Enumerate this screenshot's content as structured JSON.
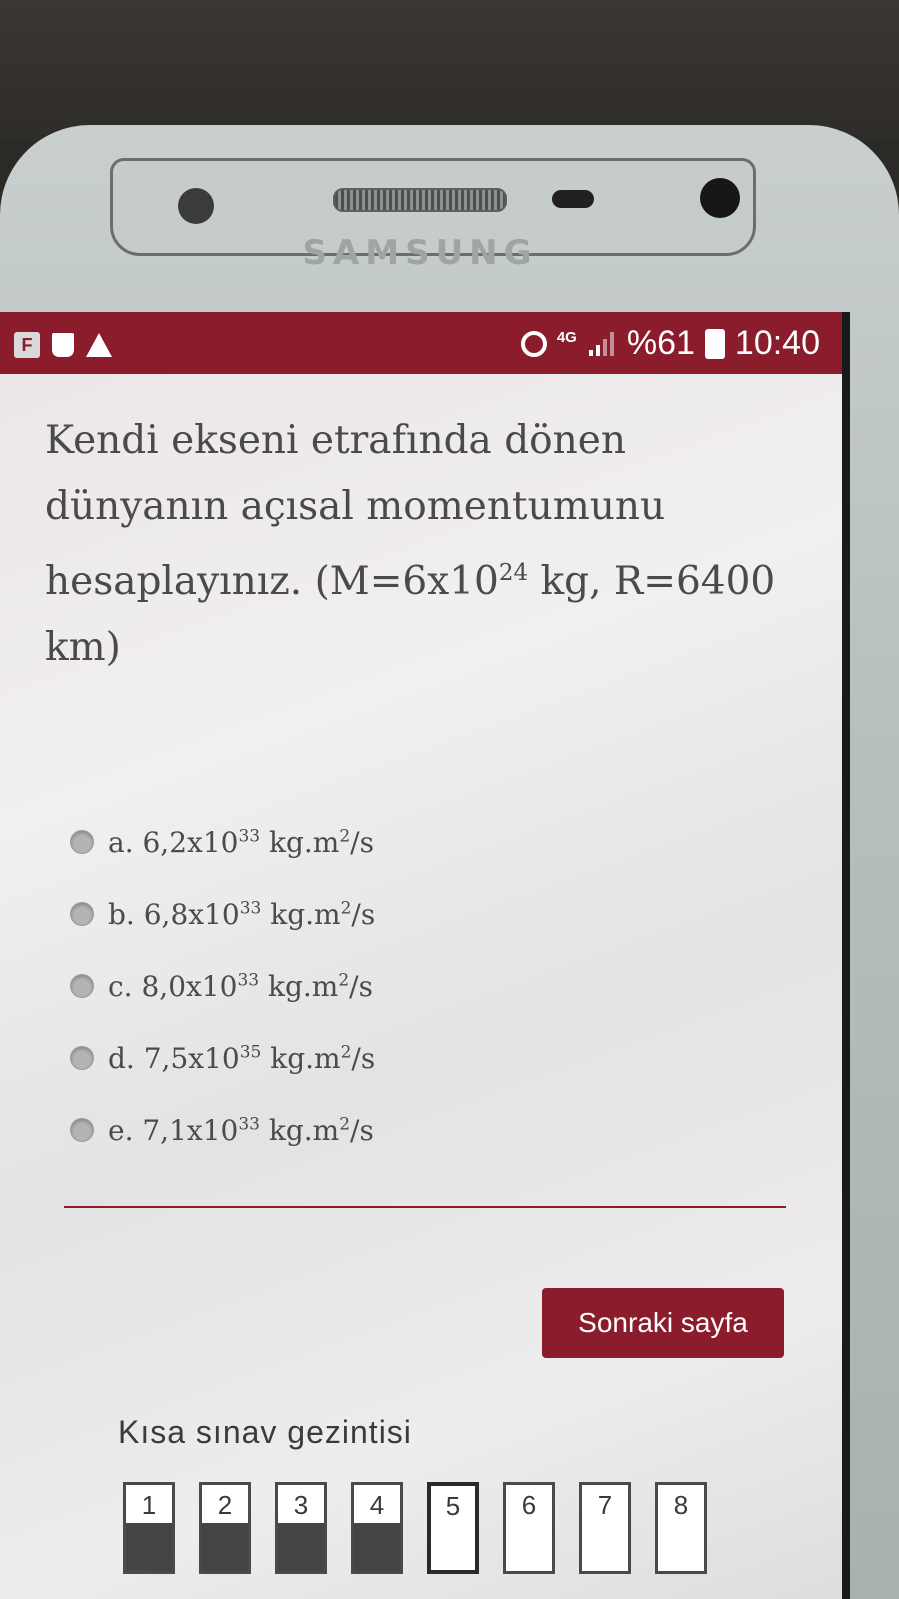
{
  "device": {
    "brand": "SAMSUNG"
  },
  "status_bar": {
    "network": "4G",
    "battery": "%61",
    "time": "10:40"
  },
  "question": {
    "text_part1": "Kendi ekseni etrafında dönen dünyanın açısal momentumunu hesaplayınız. (M=6x10",
    "text_sup": "24",
    "text_part2": " kg, R=6400 km)"
  },
  "options": [
    {
      "prefix": "a. 6,2x10",
      "exp": "33",
      "unit": " kg.m",
      "unit_exp": "2",
      "tail": "/s",
      "selected": false
    },
    {
      "prefix": "b. 6,8x10",
      "exp": "33",
      "unit": " kg.m",
      "unit_exp": "2",
      "tail": "/s",
      "selected": false
    },
    {
      "prefix": "c. 8,0x10",
      "exp": "33",
      "unit": " kg.m",
      "unit_exp": "2",
      "tail": "/s",
      "selected": false
    },
    {
      "prefix": "d. 7,5x10",
      "exp": "35",
      "unit": " kg.m",
      "unit_exp": "2",
      "tail": "/s",
      "selected": false
    },
    {
      "prefix": "e. 7,1x10",
      "exp": "33",
      "unit": " kg.m",
      "unit_exp": "2",
      "tail": "/s",
      "selected": false
    }
  ],
  "next_button": "Sonraki sayfa",
  "quiz_nav": {
    "title": "Kısa sınav gezintisi",
    "pages": [
      {
        "label": "1",
        "answered": true,
        "current": false
      },
      {
        "label": "2",
        "answered": true,
        "current": false
      },
      {
        "label": "3",
        "answered": true,
        "current": false
      },
      {
        "label": "4",
        "answered": true,
        "current": false
      },
      {
        "label": "5",
        "answered": false,
        "current": true
      },
      {
        "label": "6",
        "answered": false,
        "current": false
      },
      {
        "label": "7",
        "answered": false,
        "current": false
      },
      {
        "label": "8",
        "answered": false,
        "current": false
      }
    ]
  },
  "colors": {
    "accent": "#8b1c2c"
  }
}
